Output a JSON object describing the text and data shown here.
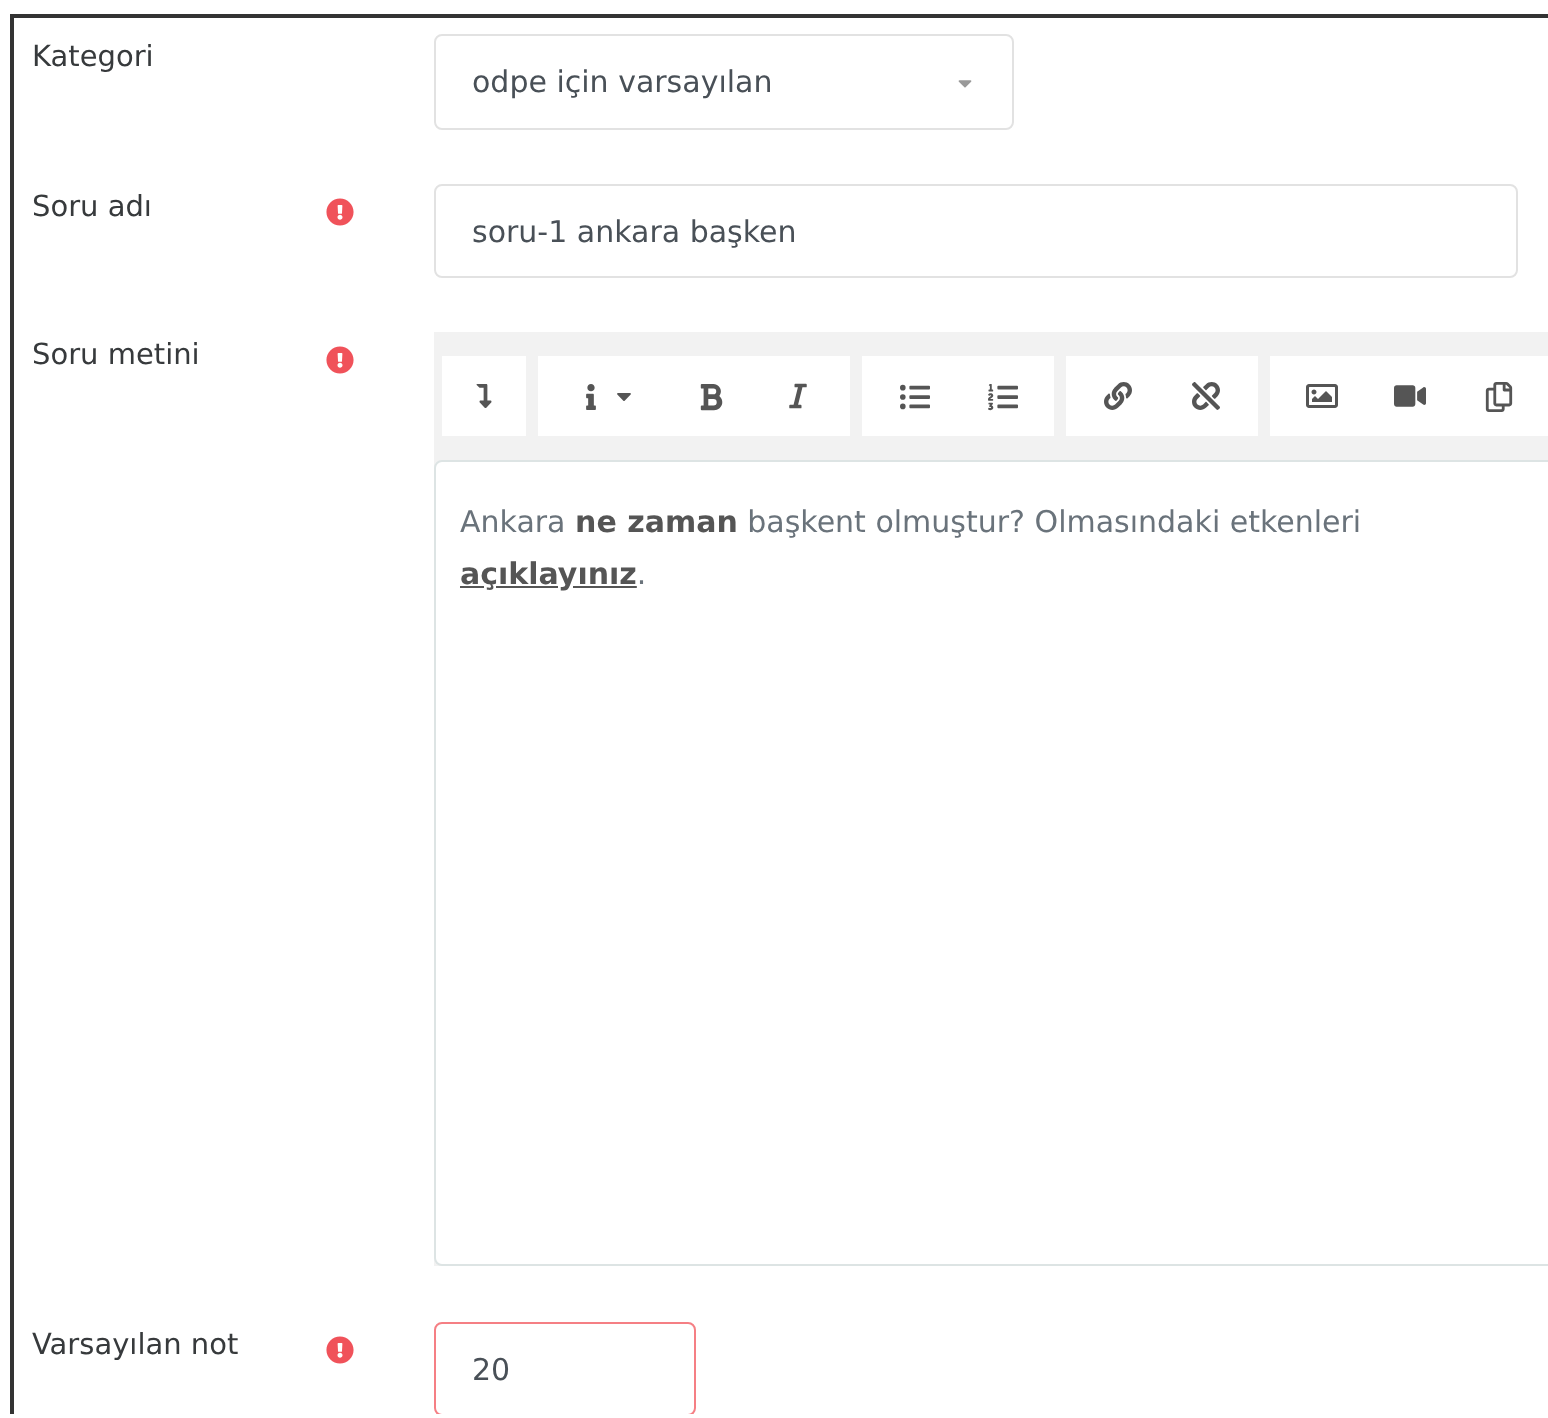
{
  "fields": [
    {
      "kind": "select",
      "label": "Kategori",
      "value": "odpe için varsayılan"
    },
    {
      "kind": "text",
      "label": "Soru adı",
      "required": true,
      "value": "soru-1 ankara başken"
    },
    {
      "kind": "editor",
      "label": "Soru metini",
      "required": true,
      "content": "Ankara **ne zaman** başkent olmuştur? Olmasındaki etkenleri **açıklayınız**."
    },
    {
      "kind": "number",
      "label": "Varsayılan not",
      "required": true,
      "invalid": true,
      "value": "20"
    }
  ]
}
